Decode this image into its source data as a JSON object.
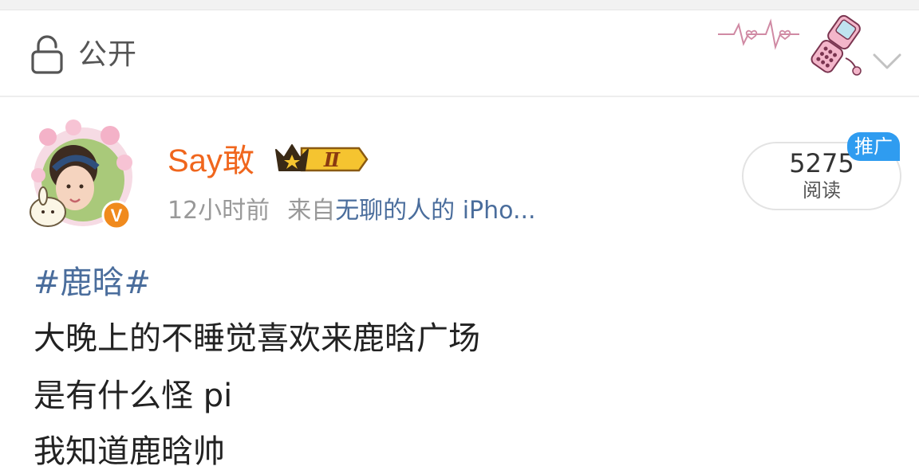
{
  "header": {
    "privacy_label": "公开",
    "icons": {
      "privacy": "lock-icon",
      "expand": "chevron-down-icon",
      "decoration": "heartbeat-phone-sticker"
    }
  },
  "post": {
    "author": {
      "name": "Say敢",
      "avatar": "avatar",
      "verified_badge": "V",
      "rank_badge": "Ⅱ"
    },
    "time": "12小时前",
    "source_prefix": "来自",
    "source_name": "无聊的人的 iPho...",
    "reads": {
      "count": "5275",
      "label": "阅读"
    },
    "promo_tag": "推广",
    "hashtag": "#鹿晗#",
    "lines": [
      "大晚上的不睡觉喜欢来鹿晗广场",
      "是有什么怪 pi",
      "我知道鹿晗帅"
    ]
  },
  "colors": {
    "username": "#f0661d",
    "link": "#4a6d9c",
    "promo": "#2f9cf0",
    "verified": "#f08a1d"
  }
}
